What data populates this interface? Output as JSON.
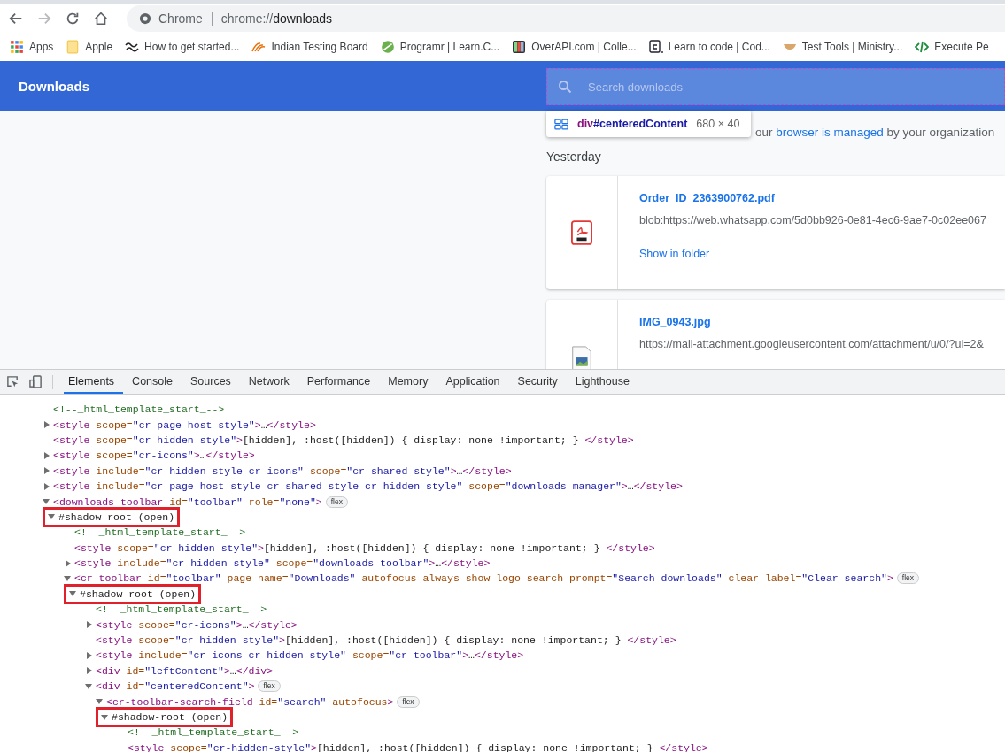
{
  "browser": {
    "nav_buttons": [
      {
        "kind": "back",
        "disabled": false
      },
      {
        "kind": "forward",
        "disabled": true
      },
      {
        "kind": "reload",
        "disabled": false
      },
      {
        "kind": "home",
        "disabled": false
      }
    ],
    "omnibox": {
      "site": "Chrome",
      "url_scheme": "chrome://",
      "url_path": "downloads"
    },
    "bookmarks": [
      {
        "kind": "apps",
        "label": "Apps"
      },
      {
        "kind": "folder",
        "label": "Apple"
      },
      {
        "kind": "wave",
        "label": "How to get started..."
      },
      {
        "kind": "swoosh",
        "label": "Indian Testing Board"
      },
      {
        "kind": "leaf",
        "label": "Programr | Learn.C..."
      },
      {
        "kind": "bars",
        "label": "OverAPI.com | Colle..."
      },
      {
        "kind": "prompt",
        "label": "Learn to code | Cod..."
      },
      {
        "kind": "bowl",
        "label": "Test Tools | Ministry..."
      },
      {
        "kind": "code",
        "label": "Execute Pe"
      }
    ]
  },
  "page": {
    "title": "Downloads",
    "search": {
      "placeholder": "Search downloads"
    },
    "inspect_tooltip": {
      "element": "div",
      "id": "#centeredContent",
      "size": "680 × 40"
    },
    "managed_notice": {
      "before": "our ",
      "link": "browser is managed",
      "after": " by your organization"
    },
    "section": "Yesterday",
    "downloads": [
      {
        "kind": "pdf",
        "file_name": "Order_ID_2363900762.pdf",
        "url": "blob:https://web.whatsapp.com/5d0bb926-0e81-4ec6-9ae7-0c02ee067",
        "action": "Show in folder"
      },
      {
        "kind": "image",
        "file_name": "IMG_0943.jpg",
        "url": "https://mail-attachment.googleusercontent.com/attachment/u/0/?ui=2&"
      }
    ]
  },
  "devtools": {
    "tabs": [
      {
        "label": "Elements",
        "selected": true
      },
      {
        "label": "Console",
        "selected": false
      },
      {
        "label": "Sources",
        "selected": false
      },
      {
        "label": "Network",
        "selected": false
      },
      {
        "label": "Performance",
        "selected": false
      },
      {
        "label": "Memory",
        "selected": false
      },
      {
        "label": "Application",
        "selected": false
      },
      {
        "label": "Security",
        "selected": false
      },
      {
        "label": "Lighthouse",
        "selected": false
      }
    ],
    "dom_tree": [
      {
        "tokens": [
          {
            "kind": "comment",
            "text": "<!--_html_template_start_-->"
          }
        ]
      },
      {
        "expanded": false,
        "tokens": [
          {
            "kind": "tag",
            "text": "<style"
          },
          {
            "kind": "attr",
            "text": " scope="
          },
          {
            "kind": "value",
            "text": "\"cr-page-host-style\""
          },
          {
            "kind": "tag",
            "text": ">"
          },
          {
            "kind": "text",
            "text": "…"
          },
          {
            "kind": "tag",
            "text": "</style>"
          }
        ]
      },
      {
        "tokens": [
          {
            "kind": "tag",
            "text": "<style"
          },
          {
            "kind": "attr",
            "text": " scope="
          },
          {
            "kind": "value",
            "text": "\"cr-hidden-style\""
          },
          {
            "kind": "tag",
            "text": ">"
          },
          {
            "kind": "text",
            "text": "[hidden], :host([hidden]) { display: none !important; } "
          },
          {
            "kind": "tag",
            "text": "</style>"
          }
        ]
      },
      {
        "expanded": false,
        "tokens": [
          {
            "kind": "tag",
            "text": "<style"
          },
          {
            "kind": "attr",
            "text": " scope="
          },
          {
            "kind": "value",
            "text": "\"cr-icons\""
          },
          {
            "kind": "tag",
            "text": ">"
          },
          {
            "kind": "text",
            "text": "…"
          },
          {
            "kind": "tag",
            "text": "</style>"
          }
        ]
      },
      {
        "expanded": false,
        "tokens": [
          {
            "kind": "tag",
            "text": "<style"
          },
          {
            "kind": "attr",
            "text": " include="
          },
          {
            "kind": "value",
            "text": "\"cr-hidden-style cr-icons\""
          },
          {
            "kind": "attr",
            "text": " scope="
          },
          {
            "kind": "value",
            "text": "\"cr-shared-style\""
          },
          {
            "kind": "tag",
            "text": ">"
          },
          {
            "kind": "text",
            "text": "…"
          },
          {
            "kind": "tag",
            "text": "</style>"
          }
        ]
      },
      {
        "expanded": false,
        "tokens": [
          {
            "kind": "tag",
            "text": "<style"
          },
          {
            "kind": "attr",
            "text": " include="
          },
          {
            "kind": "value",
            "text": "\"cr-page-host-style cr-shared-style cr-hidden-style\""
          },
          {
            "kind": "attr",
            "text": " scope="
          },
          {
            "kind": "value",
            "text": "\"downloads-manager\""
          },
          {
            "kind": "tag",
            "text": ">"
          },
          {
            "kind": "text",
            "text": "…"
          },
          {
            "kind": "tag",
            "text": "</style>"
          }
        ]
      },
      {
        "expanded": true,
        "badge": "flex",
        "tokens": [
          {
            "kind": "tag",
            "text": "<downloads-toolbar"
          },
          {
            "kind": "attr",
            "text": " id="
          },
          {
            "kind": "value",
            "text": "\"toolbar\""
          },
          {
            "kind": "attr",
            "text": " role="
          },
          {
            "kind": "value",
            "text": "\"none\""
          },
          {
            "kind": "tag",
            "text": ">"
          }
        ],
        "children": [
          {
            "expanded": true,
            "highlighted": true,
            "tokens": [
              {
                "kind": "text",
                "text": "#shadow-root (open)"
              }
            ],
            "children": [
              {
                "tokens": [
                  {
                    "kind": "comment",
                    "text": "<!--_html_template_start_-->"
                  }
                ]
              },
              {
                "tokens": [
                  {
                    "kind": "tag",
                    "text": "<style"
                  },
                  {
                    "kind": "attr",
                    "text": " scope="
                  },
                  {
                    "kind": "value",
                    "text": "\"cr-hidden-style\""
                  },
                  {
                    "kind": "tag",
                    "text": ">"
                  },
                  {
                    "kind": "text",
                    "text": "[hidden], :host([hidden]) { display: none !important; } "
                  },
                  {
                    "kind": "tag",
                    "text": "</style>"
                  }
                ]
              },
              {
                "expanded": false,
                "tokens": [
                  {
                    "kind": "tag",
                    "text": "<style"
                  },
                  {
                    "kind": "attr",
                    "text": " include="
                  },
                  {
                    "kind": "value",
                    "text": "\"cr-hidden-style\""
                  },
                  {
                    "kind": "attr",
                    "text": " scope="
                  },
                  {
                    "kind": "value",
                    "text": "\"downloads-toolbar\""
                  },
                  {
                    "kind": "tag",
                    "text": ">"
                  },
                  {
                    "kind": "text",
                    "text": "…"
                  },
                  {
                    "kind": "tag",
                    "text": "</style>"
                  }
                ]
              },
              {
                "expanded": true,
                "badge": "flex",
                "tokens": [
                  {
                    "kind": "tag",
                    "text": "<cr-toolbar"
                  },
                  {
                    "kind": "attr",
                    "text": " id="
                  },
                  {
                    "kind": "value",
                    "text": "\"toolbar\""
                  },
                  {
                    "kind": "attr",
                    "text": " page-name="
                  },
                  {
                    "kind": "value",
                    "text": "\"Downloads\""
                  },
                  {
                    "kind": "attr",
                    "text": " autofocus always-show-logo search-prompt="
                  },
                  {
                    "kind": "value",
                    "text": "\"Search downloads\""
                  },
                  {
                    "kind": "attr",
                    "text": " clear-label="
                  },
                  {
                    "kind": "value",
                    "text": "\"Clear search\""
                  },
                  {
                    "kind": "tag",
                    "text": ">"
                  }
                ],
                "children": [
                  {
                    "expanded": true,
                    "highlighted": true,
                    "tokens": [
                      {
                        "kind": "text",
                        "text": "#shadow-root (open)"
                      }
                    ],
                    "children": [
                      {
                        "tokens": [
                          {
                            "kind": "comment",
                            "text": "<!--_html_template_start_-->"
                          }
                        ]
                      },
                      {
                        "expanded": false,
                        "tokens": [
                          {
                            "kind": "tag",
                            "text": "<style"
                          },
                          {
                            "kind": "attr",
                            "text": " scope="
                          },
                          {
                            "kind": "value",
                            "text": "\"cr-icons\""
                          },
                          {
                            "kind": "tag",
                            "text": ">"
                          },
                          {
                            "kind": "text",
                            "text": "…"
                          },
                          {
                            "kind": "tag",
                            "text": "</style>"
                          }
                        ]
                      },
                      {
                        "tokens": [
                          {
                            "kind": "tag",
                            "text": "<style"
                          },
                          {
                            "kind": "attr",
                            "text": " scope="
                          },
                          {
                            "kind": "value",
                            "text": "\"cr-hidden-style\""
                          },
                          {
                            "kind": "tag",
                            "text": ">"
                          },
                          {
                            "kind": "text",
                            "text": "[hidden], :host([hidden]) { display: none !important; } "
                          },
                          {
                            "kind": "tag",
                            "text": "</style>"
                          }
                        ]
                      },
                      {
                        "expanded": false,
                        "tokens": [
                          {
                            "kind": "tag",
                            "text": "<style"
                          },
                          {
                            "kind": "attr",
                            "text": " include="
                          },
                          {
                            "kind": "value",
                            "text": "\"cr-icons cr-hidden-style\""
                          },
                          {
                            "kind": "attr",
                            "text": " scope="
                          },
                          {
                            "kind": "value",
                            "text": "\"cr-toolbar\""
                          },
                          {
                            "kind": "tag",
                            "text": ">"
                          },
                          {
                            "kind": "text",
                            "text": "…"
                          },
                          {
                            "kind": "tag",
                            "text": "</style>"
                          }
                        ]
                      },
                      {
                        "expanded": false,
                        "tokens": [
                          {
                            "kind": "tag",
                            "text": "<div"
                          },
                          {
                            "kind": "attr",
                            "text": " id="
                          },
                          {
                            "kind": "value",
                            "text": "\"leftContent\""
                          },
                          {
                            "kind": "tag",
                            "text": ">"
                          },
                          {
                            "kind": "text",
                            "text": "…"
                          },
                          {
                            "kind": "tag",
                            "text": "</div>"
                          }
                        ]
                      },
                      {
                        "expanded": true,
                        "badge": "flex",
                        "tokens": [
                          {
                            "kind": "tag",
                            "text": "<div"
                          },
                          {
                            "kind": "attr",
                            "text": " id="
                          },
                          {
                            "kind": "value",
                            "text": "\"centeredContent\""
                          },
                          {
                            "kind": "tag",
                            "text": ">"
                          }
                        ],
                        "children": [
                          {
                            "expanded": true,
                            "badge": "flex",
                            "tokens": [
                              {
                                "kind": "tag",
                                "text": "<cr-toolbar-search-field"
                              },
                              {
                                "kind": "attr",
                                "text": " id="
                              },
                              {
                                "kind": "value",
                                "text": "\"search\""
                              },
                              {
                                "kind": "attr",
                                "text": " autofocus"
                              },
                              {
                                "kind": "tag",
                                "text": ">"
                              }
                            ],
                            "children": [
                              {
                                "expanded": true,
                                "highlighted": true,
                                "tokens": [
                                  {
                                    "kind": "text",
                                    "text": "#shadow-root (open)"
                                  }
                                ],
                                "children": [
                                  {
                                    "tokens": [
                                      {
                                        "kind": "comment",
                                        "text": "<!--_html_template_start_-->"
                                      }
                                    ]
                                  },
                                  {
                                    "tokens": [
                                      {
                                        "kind": "tag",
                                        "text": "<style"
                                      },
                                      {
                                        "kind": "attr",
                                        "text": " scope="
                                      },
                                      {
                                        "kind": "value",
                                        "text": "\"cr-hidden-style\""
                                      },
                                      {
                                        "kind": "tag",
                                        "text": ">"
                                      },
                                      {
                                        "kind": "text",
                                        "text": "[hidden], :host([hidden]) { display: none !important; } "
                                      },
                                      {
                                        "kind": "tag",
                                        "text": "</style>"
                                      }
                                    ]
                                  }
                                ]
                              }
                            ]
                          }
                        ]
                      }
                    ]
                  }
                ]
              }
            ]
          }
        ]
      }
    ]
  }
}
